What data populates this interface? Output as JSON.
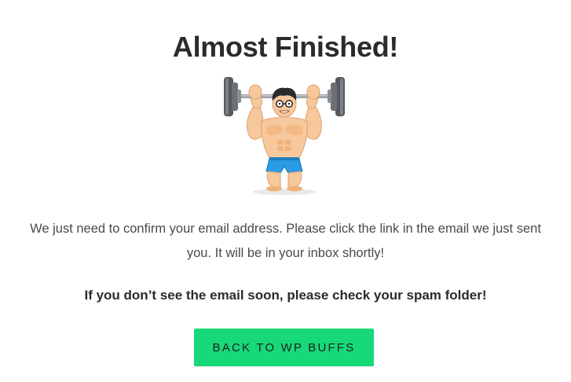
{
  "heading": "Almost Finished!",
  "illustration": {
    "icon": "weightlifter-illustration-icon",
    "skin_color": "#f7c89b",
    "shorts_color": "#2b9be6",
    "bar_color": "#9aa0a6",
    "plate_color": "#6d7176",
    "hair_color": "#2a2a2a"
  },
  "message": "We just need to confirm your email address. Please click the link in the email we just sent you. It will be in your inbox shortly!",
  "spam_note": "If you don’t see the email soon, please check your spam folder!",
  "cta": {
    "label": "BACK TO WP BUFFS",
    "color": "#17d97a"
  }
}
